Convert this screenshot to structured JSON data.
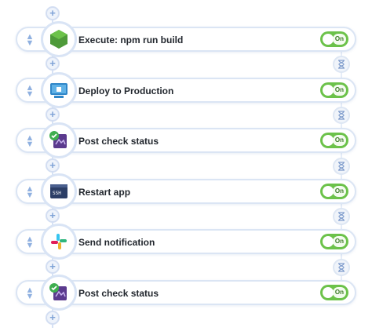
{
  "steps": [
    {
      "label": "Execute: npm run build",
      "toggle": "On",
      "icon": "nodejs-icon"
    },
    {
      "label": "Deploy to Production",
      "toggle": "On",
      "icon": "deploy-server-icon"
    },
    {
      "label": "Post check status",
      "toggle": "On",
      "icon": "check-status-icon"
    },
    {
      "label": "Restart app",
      "toggle": "On",
      "icon": "ssh-terminal-icon"
    },
    {
      "label": "Send notification",
      "toggle": "On",
      "icon": "slack-icon"
    },
    {
      "label": "Post check status",
      "toggle": "On",
      "icon": "check-status-icon"
    }
  ],
  "colors": {
    "toggle_on": "#6cc24a",
    "connector": "#d6e2f5",
    "card_border": "#dbe5f4"
  }
}
